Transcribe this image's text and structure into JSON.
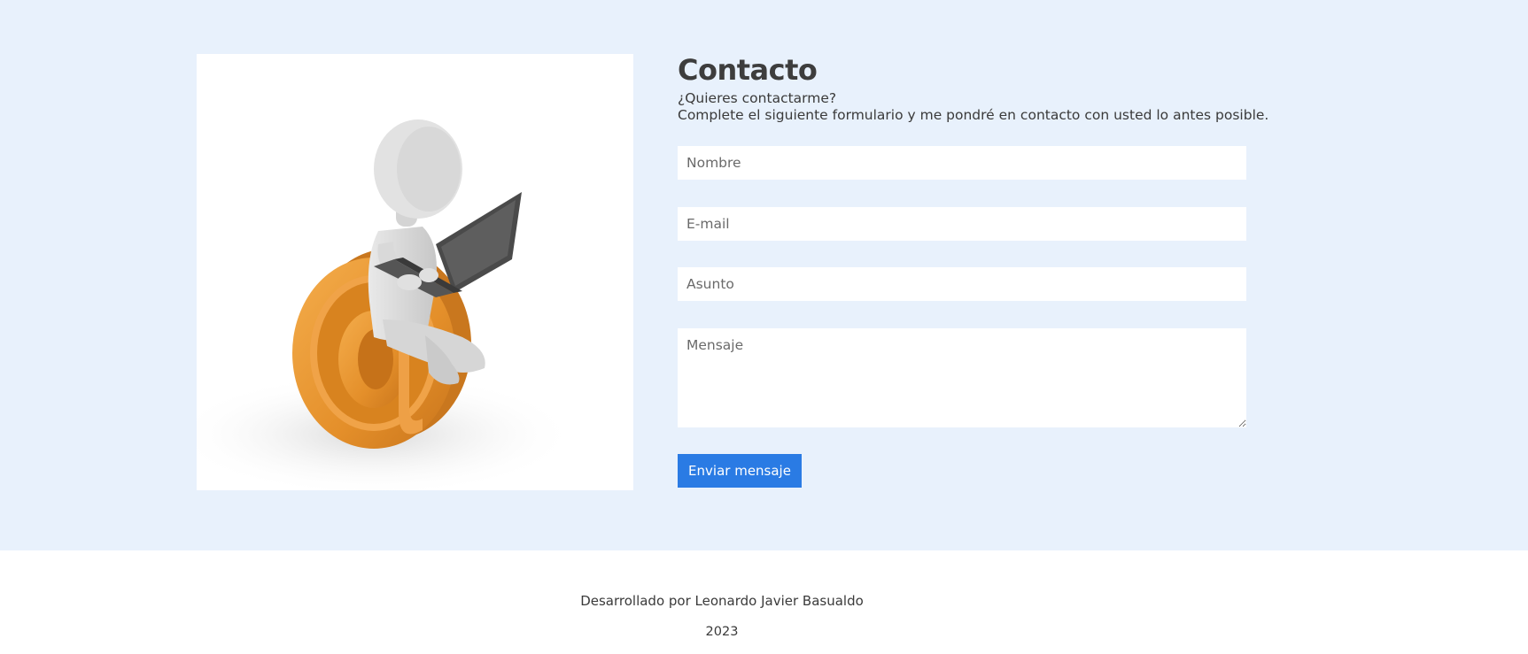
{
  "contact": {
    "title": "Contacto",
    "subtitle_line1": "¿Quieres contactarme?",
    "subtitle_line2": "Complete el siguiente formulario y me pondré en contacto con usted lo antes posible.",
    "illustration_icon": "person-with-laptop-on-at-sign",
    "form": {
      "name_placeholder": "Nombre",
      "email_placeholder": "E-mail",
      "subject_placeholder": "Asunto",
      "message_placeholder": "Mensaje",
      "submit_label": "Enviar mensaje"
    }
  },
  "footer": {
    "credit": "Desarrollado por Leonardo Javier Basualdo",
    "year": "2023"
  },
  "colors": {
    "section_background": "#e8f1fc",
    "accent": "#2a7be4",
    "at_sign": "#e8962e",
    "figure": "#dcdcdc"
  }
}
